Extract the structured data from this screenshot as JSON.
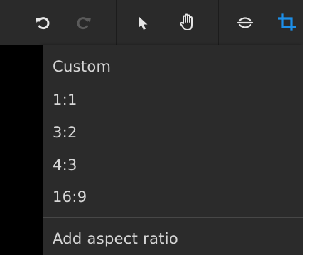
{
  "toolbar": {
    "buttons": [
      {
        "icon": "undo-icon",
        "color": "#e6e6e6",
        "enabled": true
      },
      {
        "icon": "redo-icon",
        "color": "#5a5a5a",
        "enabled": false
      },
      {
        "icon": "select-arrow-icon",
        "color": "#e6e6e6",
        "enabled": true
      },
      {
        "icon": "hand-pan-icon",
        "color": "#e6e6e6",
        "enabled": true
      },
      {
        "icon": "straighten-icon",
        "color": "#e6e6e6",
        "enabled": true
      },
      {
        "icon": "crop-icon",
        "color": "#1d8fe8",
        "enabled": true,
        "active": true
      }
    ]
  },
  "menu": {
    "items": [
      {
        "label": "Custom"
      },
      {
        "label": "1:1"
      },
      {
        "label": "3:2"
      },
      {
        "label": "4:3"
      },
      {
        "label": "16:9"
      }
    ],
    "add_label": "Add aspect ratio"
  },
  "colors": {
    "toolbar_bg": "#2a2a2a",
    "menu_bg": "#2b2b2b",
    "menu_text": "#d6d6d6",
    "accent": "#1d8fe8",
    "canvas": "#000000"
  }
}
